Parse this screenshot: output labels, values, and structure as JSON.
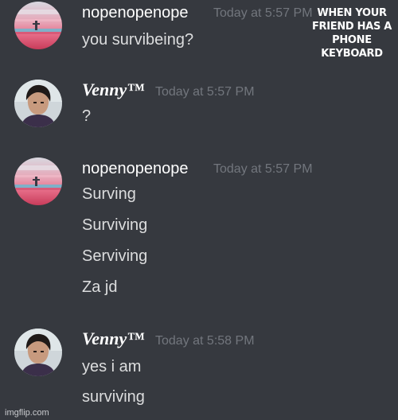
{
  "caption": "WHEN YOUR FRIEND HAS A PHONE KEYBOARD",
  "watermark": "imgflip.com",
  "messages": [
    {
      "username": "nopenopenope",
      "timestamp": "Today at 5:57 PM",
      "lines": [
        "you survibeing?"
      ]
    },
    {
      "username": "Venny™",
      "timestamp": "Today at 5:57 PM",
      "lines": [
        "?"
      ]
    },
    {
      "username": "nopenopenope",
      "timestamp": "Today at 5:57 PM",
      "lines": [
        "Surving",
        "Surviving",
        "Serviving",
        "Za jd"
      ]
    },
    {
      "username": "Venny™",
      "timestamp": "Today at 5:58 PM",
      "lines": [
        "yes i am",
        "surviving"
      ]
    }
  ]
}
